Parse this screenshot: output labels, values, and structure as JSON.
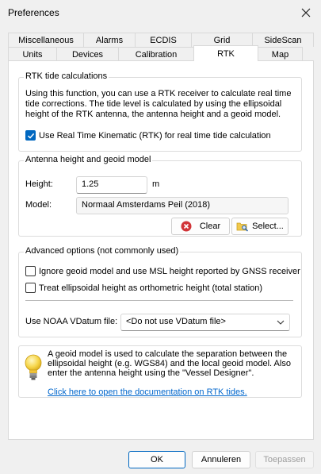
{
  "window": {
    "title": "Preferences"
  },
  "tabs": {
    "row1": [
      "Miscellaneous",
      "Alarms",
      "ECDIS",
      "Grid",
      "SideScan"
    ],
    "row2": [
      "Units",
      "Devices",
      "Calibration",
      "RTK",
      "Map"
    ],
    "active": "RTK"
  },
  "rtk": {
    "title": "RTK tide calculations",
    "description": "Using this function, you can use a RTK receiver to calculate real time tide corrections. The tide level is calculated by using the ellipsoidal height of the RTK antenna, the antenna height and a geoid model.",
    "use_rtk_label": "Use Real Time Kinematic (RTK) for real time tide calculation",
    "use_rtk_checked": true
  },
  "antenna": {
    "title": "Antenna height and geoid model",
    "height_label": "Height:",
    "height_value": "1.25",
    "height_unit": "m",
    "model_label": "Model:",
    "model_value": "Normaal Amsterdams Peil (2018)",
    "clear_label": "Clear",
    "select_label": "Select..."
  },
  "advanced": {
    "title": "Advanced options (not commonly used)",
    "ignore_geoid_label": "Ignore geoid model and use MSL height reported by GNSS receiver",
    "ignore_geoid_checked": false,
    "treat_ortho_label": "Treat ellipsoidal height as orthometric height (total station)",
    "treat_ortho_checked": false,
    "vdatum_label": "Use NOAA VDatum file:",
    "vdatum_value": "<Do not use VDatum file>"
  },
  "info": {
    "text": "A geoid model is used to calculate the separation between the ellipsoidal height (e.g. WGS84) and the local geoid model. Also enter the antenna height using the \"Vessel Designer\".",
    "link": "Click here to open the documentation on RTK tides."
  },
  "footer": {
    "ok_label": "OK",
    "cancel_label": "Annuleren",
    "apply_label": "Toepassen"
  },
  "colors": {
    "accent": "#0067c0",
    "link": "#0066cc",
    "clear_icon": "#d13438"
  }
}
